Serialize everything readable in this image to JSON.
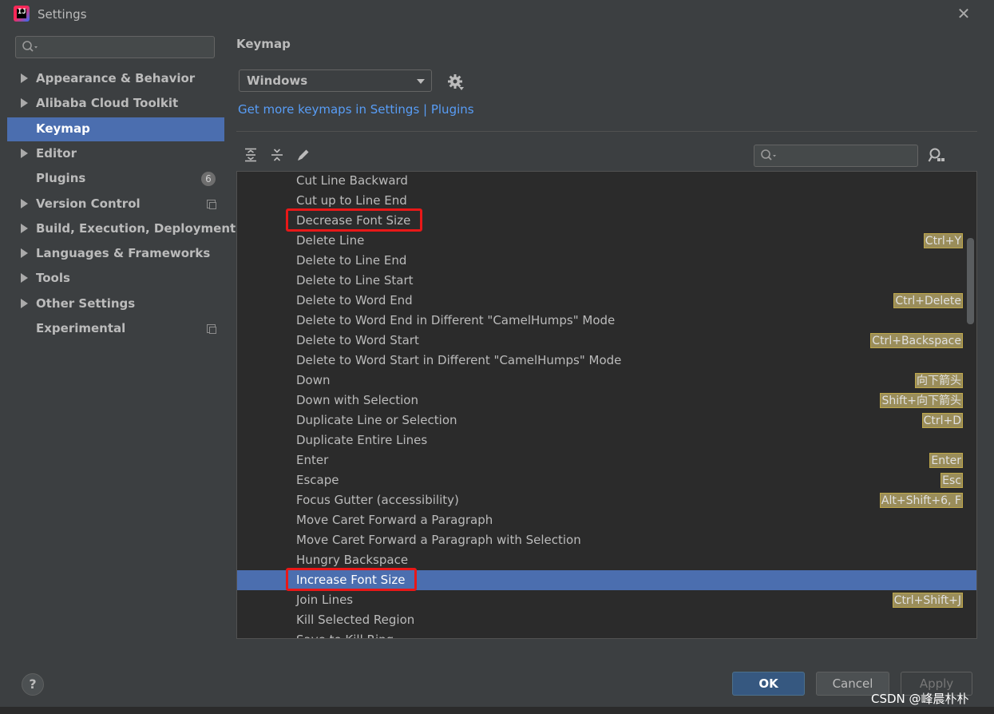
{
  "window": {
    "title": "Settings"
  },
  "sidebar": {
    "search": {
      "placeholder": ""
    },
    "items": [
      {
        "label": "Appearance & Behavior",
        "arrow": true
      },
      {
        "label": "Alibaba Cloud Toolkit",
        "arrow": true
      },
      {
        "label": "Keymap",
        "arrow": false,
        "selected": true
      },
      {
        "label": "Editor",
        "arrow": true
      },
      {
        "label": "Plugins",
        "arrow": false,
        "badge": "6"
      },
      {
        "label": "Version Control",
        "arrow": true,
        "copy_icon": true
      },
      {
        "label": "Build, Execution, Deployment",
        "arrow": true
      },
      {
        "label": "Languages & Frameworks",
        "arrow": true
      },
      {
        "label": "Tools",
        "arrow": true
      },
      {
        "label": "Other Settings",
        "arrow": true
      },
      {
        "label": "Experimental",
        "arrow": false,
        "copy_icon": true
      }
    ]
  },
  "main": {
    "title": "Keymap",
    "keymap_select": {
      "value": "Windows"
    },
    "link": "Get more keymaps in Settings | Plugins",
    "search": {
      "placeholder": ""
    },
    "actions": [
      {
        "name": "Cut Line Backward"
      },
      {
        "name": "Cut up to Line End"
      },
      {
        "name": "Decrease Font Size",
        "highlighted": true
      },
      {
        "name": "Delete Line",
        "shortcut": "Ctrl+Y"
      },
      {
        "name": "Delete to Line End"
      },
      {
        "name": "Delete to Line Start"
      },
      {
        "name": "Delete to Word End",
        "shortcut": "Ctrl+Delete"
      },
      {
        "name": "Delete to Word End in Different \"CamelHumps\" Mode"
      },
      {
        "name": "Delete to Word Start",
        "shortcut": "Ctrl+Backspace"
      },
      {
        "name": "Delete to Word Start in Different \"CamelHumps\" Mode"
      },
      {
        "name": "Down",
        "shortcut": "向下箭头"
      },
      {
        "name": "Down with Selection",
        "shortcut": "Shift+向下箭头"
      },
      {
        "name": "Duplicate Line or Selection",
        "shortcut": "Ctrl+D"
      },
      {
        "name": "Duplicate Entire Lines"
      },
      {
        "name": "Enter",
        "shortcut": "Enter"
      },
      {
        "name": "Escape",
        "shortcut": "Esc"
      },
      {
        "name": "Focus Gutter (accessibility)",
        "shortcut": "Alt+Shift+6, F"
      },
      {
        "name": "Move Caret Forward a Paragraph"
      },
      {
        "name": "Move Caret Forward a Paragraph with Selection"
      },
      {
        "name": "Hungry Backspace"
      },
      {
        "name": "Increase Font Size",
        "selected": true,
        "highlighted": true
      },
      {
        "name": "Join Lines",
        "shortcut": "Ctrl+Shift+J"
      },
      {
        "name": "Kill Selected Region"
      },
      {
        "name": "Save to Kill Ring"
      }
    ]
  },
  "footer": {
    "help_label": "?",
    "ok_label": "OK",
    "cancel_label": "Cancel",
    "apply_label": "Apply"
  },
  "watermark": "CSDN @峰晨朴朴",
  "colors": {
    "accent": "#4b6eaf",
    "link": "#589df6",
    "highlight_box": "#e81818",
    "shortcut_bg": "#9a8d5a"
  }
}
